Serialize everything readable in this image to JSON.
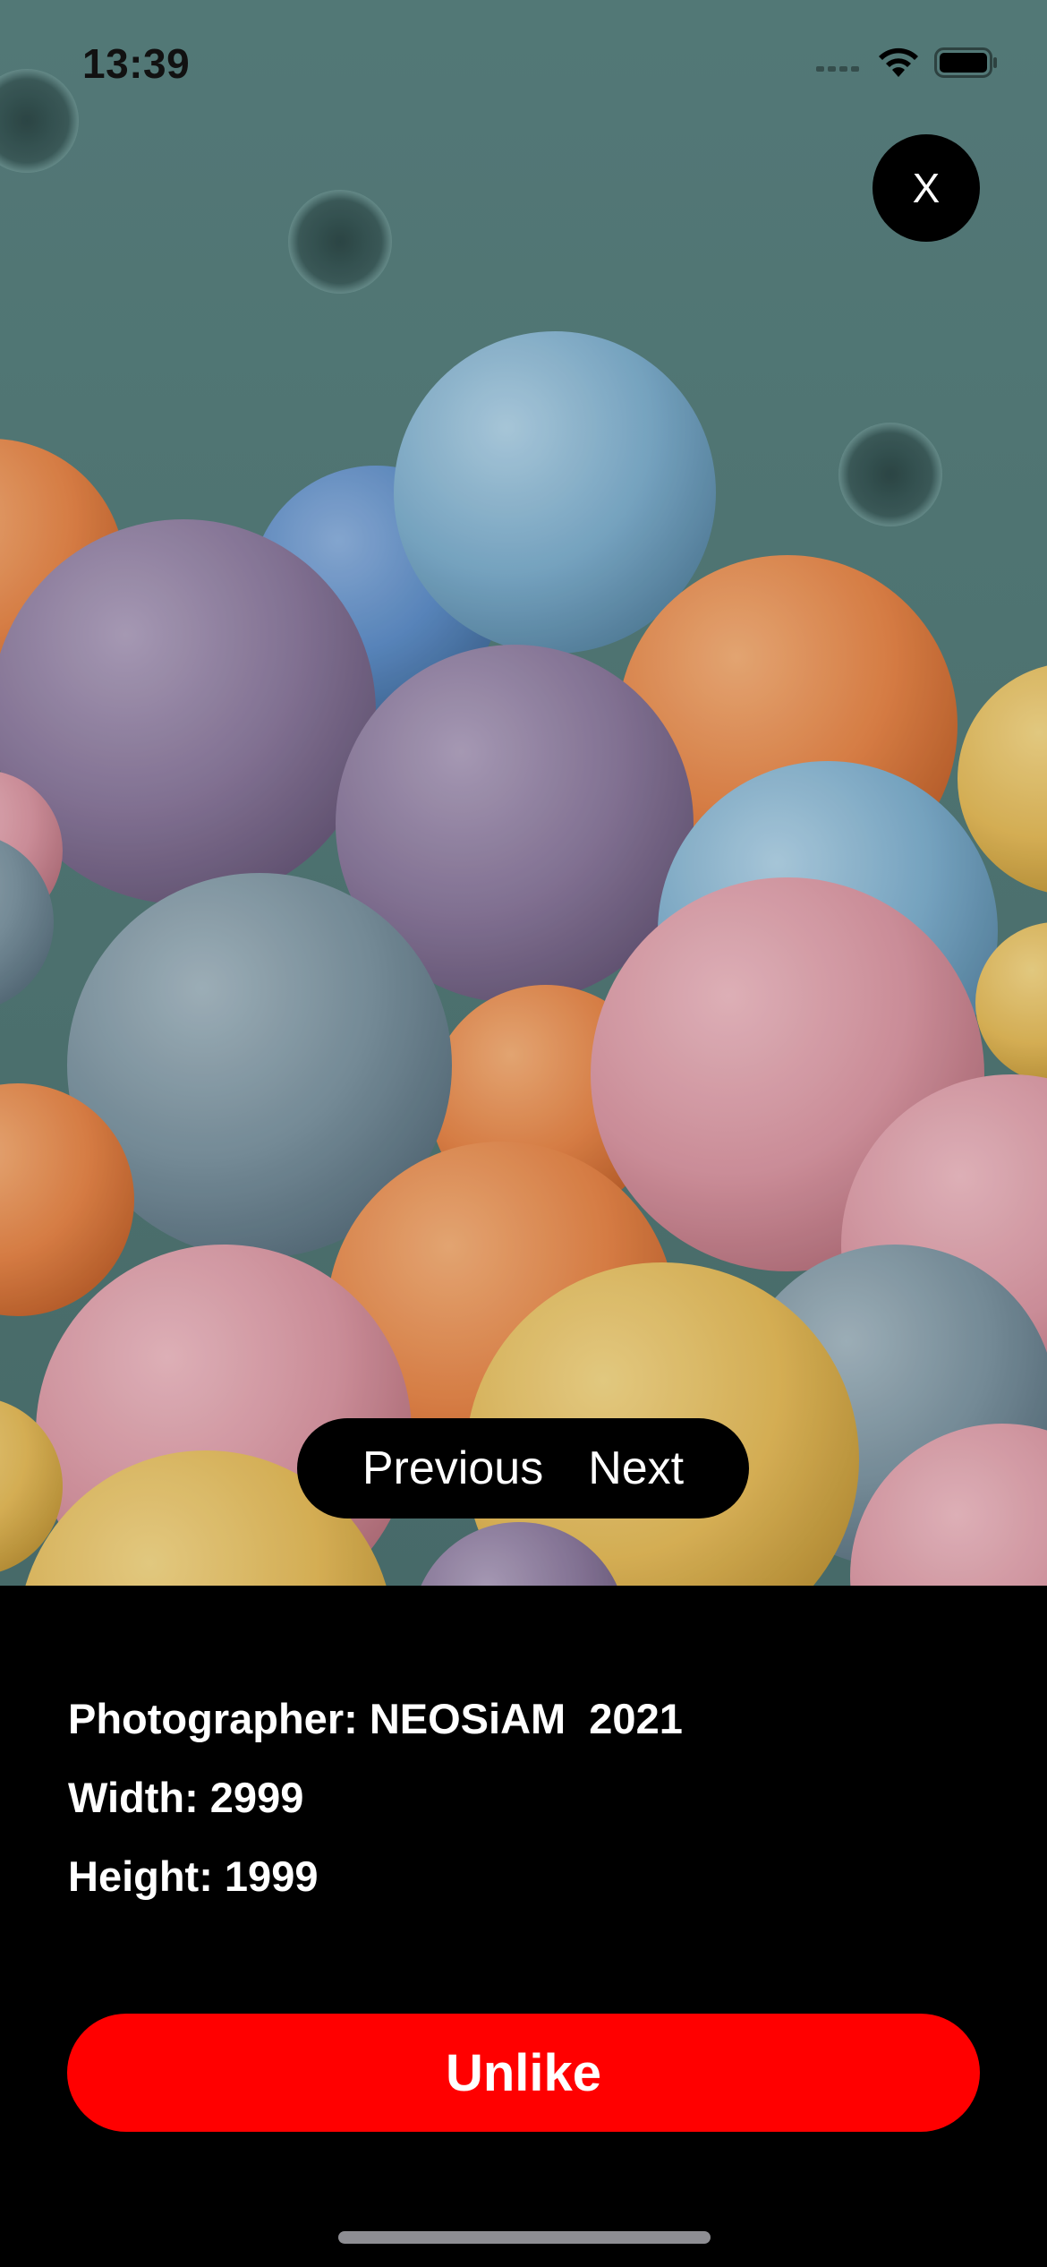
{
  "status_bar": {
    "time": "13:39",
    "signal_icon": "cellular-signal-icon",
    "wifi_icon": "wifi-icon",
    "battery_icon": "battery-icon"
  },
  "photo": {
    "description_icon": "photo-image",
    "colors": {
      "background": "#5e8583",
      "blue": "#7fb0cf",
      "purple": "#8c7a9e",
      "orange": "#e8874a",
      "pink": "#dc99a5",
      "yellow": "#e6bc5b",
      "slate": "#7d95a2"
    }
  },
  "close_button": {
    "label": "X"
  },
  "pager": {
    "previous_label": "Previous",
    "next_label": "Next"
  },
  "info": {
    "photographer": "Photographer: NEOSiAM  2021",
    "width": "Width: 2999",
    "height": "Height: 1999"
  },
  "actions": {
    "unlike_label": "Unlike",
    "unlike_color": "#ff0000"
  }
}
